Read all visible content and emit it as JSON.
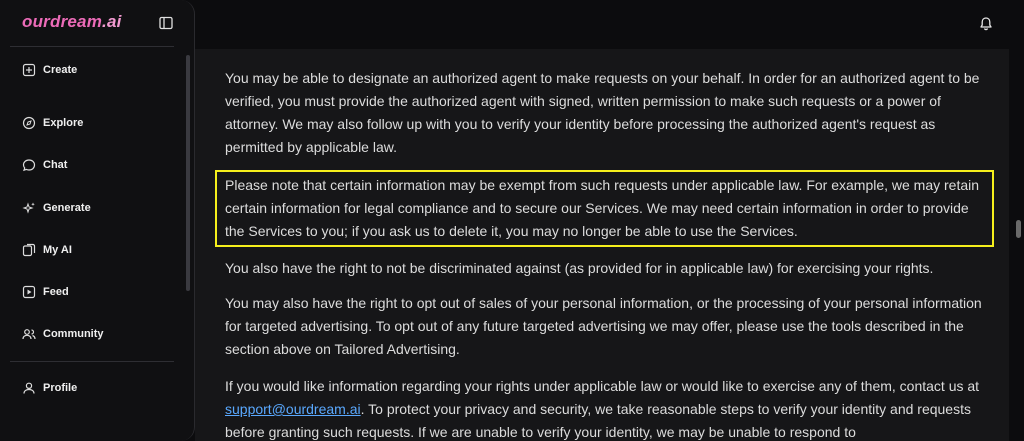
{
  "app": {
    "logo_main": "ourdream",
    "logo_ext": ".ai"
  },
  "sidebar": {
    "items": [
      {
        "label": "Create"
      },
      {
        "label": "Explore"
      },
      {
        "label": "Chat"
      },
      {
        "label": "Generate"
      },
      {
        "label": "My AI"
      },
      {
        "label": "Feed"
      },
      {
        "label": "Community"
      },
      {
        "label": "Profile"
      }
    ]
  },
  "content": {
    "p1": "You may be able to designate an authorized agent to make requests on your behalf. In order for an authorized agent to be verified, you must provide the authorized agent with signed, written permission to make such requests or a power of attorney. We may also follow up with you to verify your identity before processing the authorized agent's request as permitted by applicable law.",
    "p2": "Please note that certain information may be exempt from such requests under applicable law. For example, we may retain certain information for legal compliance and to secure our Services. We may need certain information in order to provide the Services to you; if you ask us to delete it, you may no longer be able to use the Services.",
    "p3": "You also have the right to not be discriminated against (as provided for in applicable law) for exercising your rights.",
    "p4": "You may also have the right to opt out of sales of your personal information, or the processing of your personal information for targeted advertising. To opt out of any future targeted advertising we may offer, please use the tools described in the section above on Tailored Advertising.",
    "p5_before": "If you would like information regarding your rights under applicable law or would like to exercise any of them, contact us at ",
    "p5_link": "support@ourdream.ai",
    "p5_after": ". To protect your privacy and security, we take reasonable steps to verify your identity and requests before granting such requests. If we are unable to verify your identity, we may be unable to respond to"
  },
  "colors": {
    "highlight": "#f5ef1c",
    "brand": "#ec6bb8",
    "link": "#5aa9ff"
  }
}
